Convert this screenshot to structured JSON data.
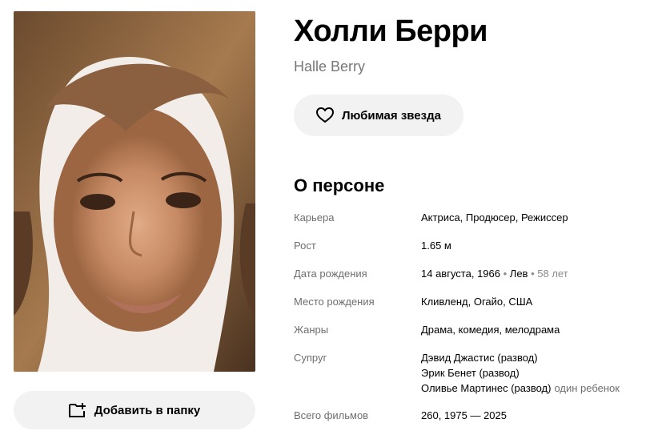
{
  "person": {
    "name": "Холли Берри",
    "original_name": "Halle Berry"
  },
  "actions": {
    "favorite_label": "Любимая звезда",
    "add_folder_label": "Добавить в папку"
  },
  "about": {
    "title": "О персоне",
    "career": {
      "label": "Карьера",
      "value": "Актриса, Продюсер, Режиссер"
    },
    "height": {
      "label": "Рост",
      "value": "1.65 м"
    },
    "birth_date": {
      "label": "Дата рождения",
      "date": "14 августа, 1966",
      "sign": "Лев",
      "age": "58 лет"
    },
    "birth_place": {
      "label": "Место рождения",
      "value": "Кливленд, Огайо, США"
    },
    "genres": {
      "label": "Жанры",
      "value": "Драма, комедия, мелодрама"
    },
    "spouse": {
      "label": "Супруг",
      "items": [
        {
          "name": "Дэвид Джастис (развод)",
          "note": ""
        },
        {
          "name": "Эрик Бенет (развод)",
          "note": ""
        },
        {
          "name": "Оливье Мартинес (развод)",
          "note": "один ребенок"
        }
      ]
    },
    "total_films": {
      "label": "Всего фильмов",
      "value": "260, 1975 — 2025"
    }
  },
  "icons": {
    "favorite": "heart-icon",
    "add_folder": "folder-plus-icon"
  }
}
